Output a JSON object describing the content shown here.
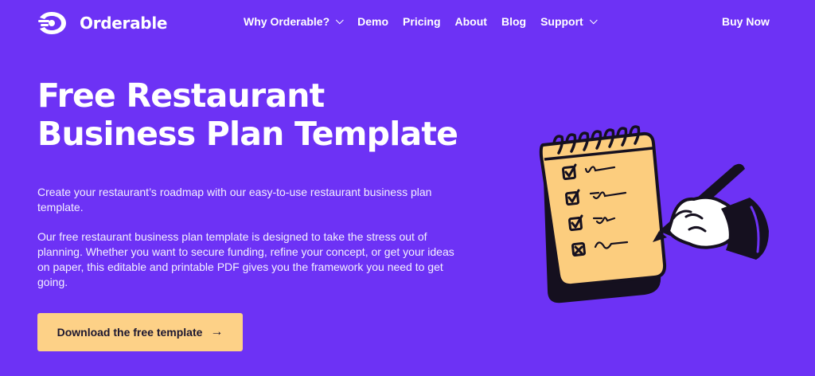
{
  "nav": {
    "logo_text": "Orderable",
    "links": [
      {
        "label": "Why Orderable?",
        "dropdown": true
      },
      {
        "label": "Demo",
        "dropdown": false
      },
      {
        "label": "Pricing",
        "dropdown": false
      },
      {
        "label": "About",
        "dropdown": false
      },
      {
        "label": "Blog",
        "dropdown": false
      },
      {
        "label": "Support",
        "dropdown": true
      }
    ],
    "buy_label": "Buy Now"
  },
  "hero": {
    "title": "Free Restaurant Business Plan Template",
    "intro": "Create your restaurant’s roadmap with our easy-to-use restaurant business plan template.",
    "body": "Our free restaurant business plan template is designed to take the stress out of planning. Whether you want to secure funding, refine your concept, or get your ideas on paper, this editable and printable PDF gives you the framework you need to get going.",
    "cta_label": "Download the free template",
    "cta_icon": "arrow-right-icon"
  },
  "colors": {
    "background": "#6d32f5",
    "cta": "#fdd187",
    "text": "#ffffff",
    "notepad": "#fccd7e",
    "ink": "#15101f"
  },
  "illustration": {
    "icon": "notepad-checklist-icon"
  }
}
